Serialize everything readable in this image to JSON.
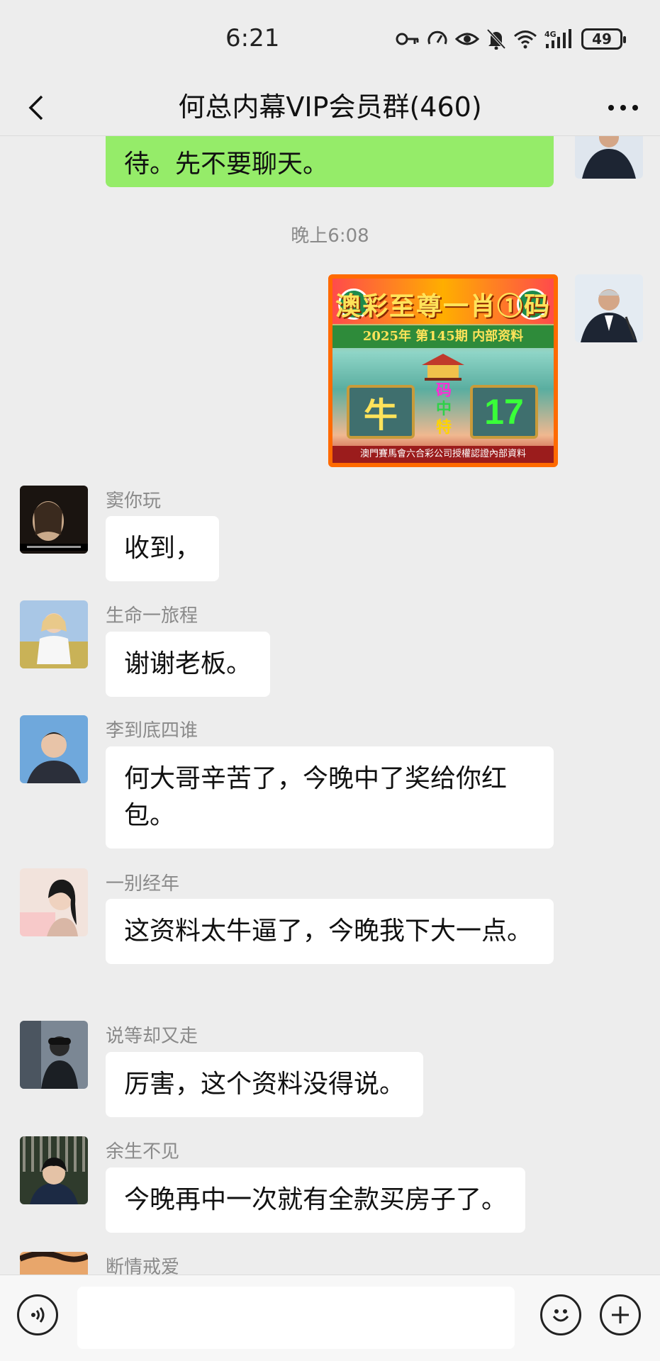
{
  "status_bar": {
    "time": "6:21",
    "battery": "49",
    "icons": [
      "key-icon",
      "speedometer-icon",
      "eye-icon",
      "bell-off-icon",
      "wifi-icon",
      "signal-4g-icon",
      "battery-icon"
    ],
    "network_label": "4G"
  },
  "header": {
    "title": "何总内幕VIP会员群(460)",
    "back_icon": "chevron-left-icon",
    "more_icon": "more-dots-icon"
  },
  "messages": {
    "outgoing_text": {
      "text": "待。先不要聊天。",
      "bubble_color": "#95EC69"
    },
    "timestamp": "晚上6:08",
    "outgoing_image": {
      "title": "澳彩至尊一肖①码",
      "subtitle": "2025年 第145期 内部资料",
      "zodiac": "牛",
      "number": "17",
      "middle_chars": [
        "码",
        "中",
        "特"
      ],
      "footer": "澳門賽馬會六合彩公司授權認證內部資料",
      "border_color": "#FF6A00"
    },
    "incoming": [
      {
        "sender": "窦你玩",
        "text": "收到，"
      },
      {
        "sender": "生命一旅程",
        "text": "谢谢老板。"
      },
      {
        "sender": "李到底四谁",
        "text": "何大哥辛苦了，今晚中了奖给你红包。"
      },
      {
        "sender": "一别经年",
        "text": "这资料太牛逼了，今晚我下大一点。"
      },
      {
        "sender": "说等却又走",
        "text": "厉害，这个资料没得说。"
      },
      {
        "sender": "余生不见",
        "text": "今晚再中一次就有全款买房子了。"
      },
      {
        "sender": "断情戒爱",
        "text": ""
      }
    ]
  },
  "input_bar": {
    "voice_icon": "voice-icon",
    "emoji_icon": "emoji-icon",
    "plus_icon": "plus-icon",
    "input_value": ""
  },
  "colors": {
    "background": "#EDEDED",
    "outgoing_bubble": "#95EC69",
    "incoming_bubble": "#FFFFFF",
    "secondary_text": "#8a8a8a"
  }
}
